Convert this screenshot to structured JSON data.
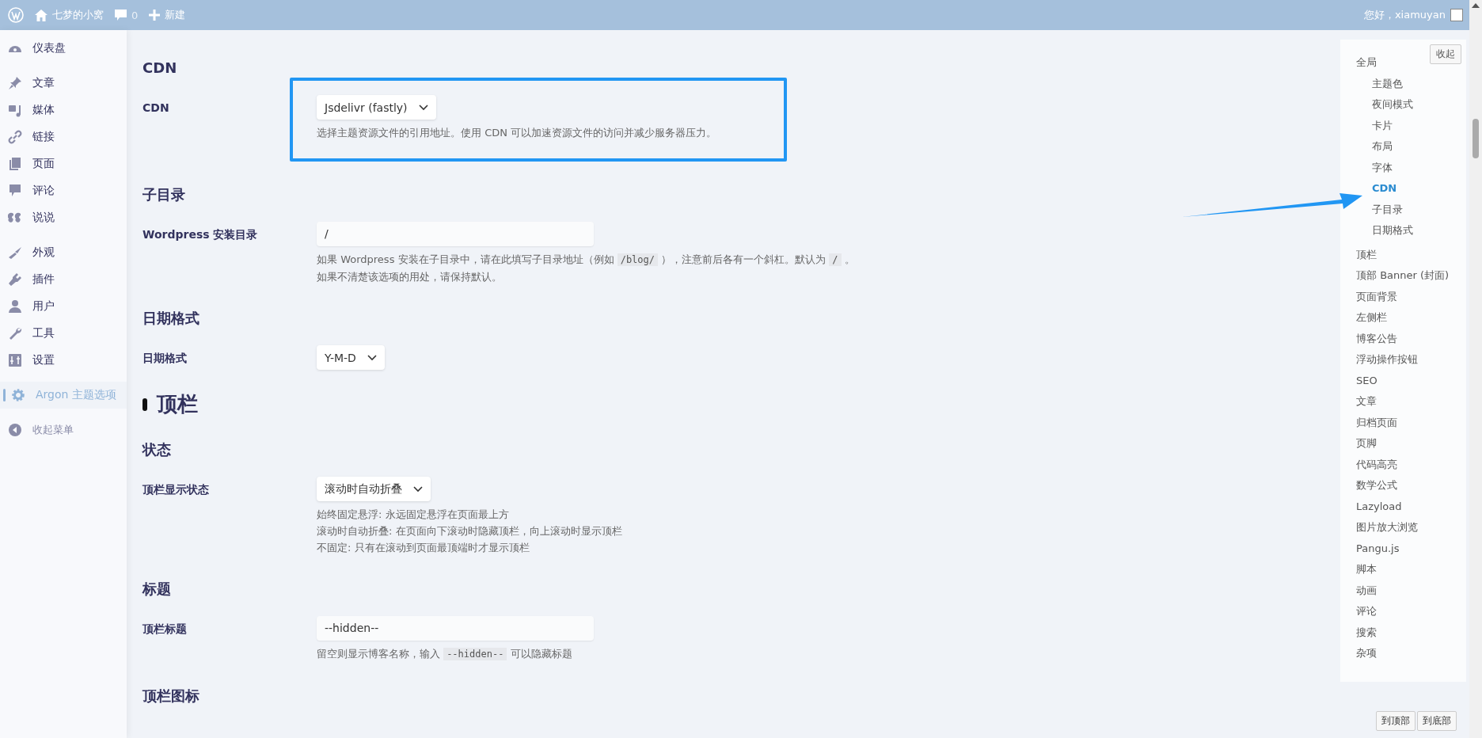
{
  "top_bar": {
    "site_name": "七梦的小窝",
    "comments_count": "0",
    "new_label": "新建",
    "greeting": "您好，xiamuyan"
  },
  "sidebar": {
    "groups": [
      [
        {
          "label": "仪表盘",
          "selected": false
        }
      ],
      [
        {
          "label": "文章",
          "selected": false
        },
        {
          "label": "媒体",
          "selected": false
        },
        {
          "label": "链接",
          "selected": false
        },
        {
          "label": "页面",
          "selected": false
        },
        {
          "label": "评论",
          "selected": false
        },
        {
          "label": "说说",
          "selected": false
        }
      ],
      [
        {
          "label": "外观",
          "selected": false
        },
        {
          "label": "插件",
          "selected": false
        },
        {
          "label": "用户",
          "selected": false
        },
        {
          "label": "工具",
          "selected": false
        },
        {
          "label": "设置",
          "selected": false
        }
      ],
      [
        {
          "label": "Argon 主题选项",
          "selected": true
        }
      ]
    ],
    "collapse_label": "收起菜单"
  },
  "main": {
    "sections": [
      {
        "kind": "h3",
        "title": "CDN"
      },
      {
        "kind": "row",
        "label": "CDN",
        "highlighted": true,
        "field": {
          "kind": "select",
          "value": "Jsdelivr (fastly)"
        },
        "description": [
          [
            {
              "kind": "text",
              "text": "选择主题资源文件的引用地址。使用 CDN 可以加速资源文件的访问并减少服务器压力。"
            }
          ]
        ]
      },
      {
        "kind": "h3",
        "title": "子目录"
      },
      {
        "kind": "row",
        "label": "Wordpress 安装目录",
        "highlighted": false,
        "field": {
          "kind": "input",
          "value": "/"
        },
        "description": [
          [
            {
              "kind": "text",
              "text": "如果 Wordpress 安装在子目录中，请在此填写子目录地址（例如 "
            },
            {
              "kind": "code",
              "text": "/blog/"
            },
            {
              "kind": "text",
              "text": " ），注意前后各有一个斜杠。默认为 "
            },
            {
              "kind": "code",
              "text": "/"
            },
            {
              "kind": "text",
              "text": " 。"
            }
          ],
          [
            {
              "kind": "text",
              "text": "如果不清楚该选项的用处，请保持默认。"
            }
          ]
        ]
      },
      {
        "kind": "h3",
        "title": "日期格式"
      },
      {
        "kind": "row",
        "label": "日期格式",
        "highlighted": false,
        "field": {
          "kind": "select",
          "value": "Y-M-D"
        }
      },
      {
        "kind": "h2",
        "title": "顶栏"
      },
      {
        "kind": "h3",
        "title": "状态"
      },
      {
        "kind": "row",
        "label": "顶栏显示状态",
        "highlighted": false,
        "field": {
          "kind": "select",
          "value": "滚动时自动折叠"
        },
        "description": [
          [
            {
              "kind": "text",
              "text": "始终固定悬浮: 永远固定悬浮在页面最上方"
            }
          ],
          [
            {
              "kind": "text",
              "text": "滚动时自动折叠: 在页面向下滚动时隐藏顶栏，向上滚动时显示顶栏"
            }
          ],
          [
            {
              "kind": "text",
              "text": "不固定: 只有在滚动到页面最顶端时才显示顶栏"
            }
          ]
        ]
      },
      {
        "kind": "h3",
        "title": "标题"
      },
      {
        "kind": "row",
        "label": "顶栏标题",
        "highlighted": false,
        "field": {
          "kind": "input",
          "value": "--hidden--"
        },
        "description": [
          [
            {
              "kind": "text",
              "text": "留空则显示博客名称，输入 "
            },
            {
              "kind": "code",
              "text": "--hidden--"
            },
            {
              "kind": "text",
              "text": " 可以隐藏标题"
            }
          ]
        ]
      },
      {
        "kind": "h3",
        "title": "顶栏图标"
      }
    ]
  },
  "toc": {
    "collapse_button": "收起",
    "items": [
      {
        "label": "全局",
        "selected": false,
        "children": [
          {
            "label": "主题色",
            "selected": false
          },
          {
            "label": "夜间模式",
            "selected": false
          },
          {
            "label": "卡片",
            "selected": false
          },
          {
            "label": "布局",
            "selected": false
          },
          {
            "label": "字体",
            "selected": false
          },
          {
            "label": "CDN",
            "selected": true
          },
          {
            "label": "子目录",
            "selected": false
          },
          {
            "label": "日期格式",
            "selected": false
          }
        ]
      },
      {
        "label": "顶栏",
        "selected": false
      },
      {
        "label": "顶部 Banner (封面)",
        "selected": false
      },
      {
        "label": "页面背景",
        "selected": false
      },
      {
        "label": "左侧栏",
        "selected": false
      },
      {
        "label": "博客公告",
        "selected": false
      },
      {
        "label": "浮动操作按钮",
        "selected": false
      },
      {
        "label": "SEO",
        "selected": false
      },
      {
        "label": "文章",
        "selected": false
      },
      {
        "label": "归档页面",
        "selected": false
      },
      {
        "label": "页脚",
        "selected": false
      },
      {
        "label": "代码高亮",
        "selected": false
      },
      {
        "label": "数学公式",
        "selected": false
      },
      {
        "label": "Lazyload",
        "selected": false
      },
      {
        "label": "图片放大浏览",
        "selected": false
      },
      {
        "label": "Pangu.js",
        "selected": false
      },
      {
        "label": "脚本",
        "selected": false
      },
      {
        "label": "动画",
        "selected": false
      },
      {
        "label": "评论",
        "selected": false
      },
      {
        "label": "搜索",
        "selected": false
      },
      {
        "label": "杂项",
        "selected": false
      }
    ]
  },
  "scroll_buttons": [
    "到顶部",
    "到底部"
  ]
}
